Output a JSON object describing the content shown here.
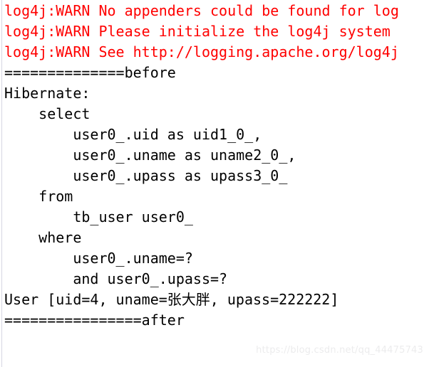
{
  "window": {
    "type": "console-output",
    "background_color": "#ffffff",
    "warn_color": "#ff0000",
    "text_color": "#000000",
    "gutter_color": "#d6d7e2"
  },
  "console": {
    "lines": [
      {
        "text": "log4j:WARN No appenders could be found for log",
        "level": "warn"
      },
      {
        "text": "log4j:WARN Please initialize the log4j system",
        "level": "warn"
      },
      {
        "text": "log4j:WARN See http://logging.apache.org/log4j",
        "level": "warn"
      },
      {
        "text": "==============before",
        "level": "info"
      },
      {
        "text": "Hibernate: ",
        "level": "info"
      },
      {
        "text": "    select",
        "level": "info"
      },
      {
        "text": "        user0_.uid as uid1_0_,",
        "level": "info"
      },
      {
        "text": "        user0_.uname as uname2_0_,",
        "level": "info"
      },
      {
        "text": "        user0_.upass as upass3_0_",
        "level": "info"
      },
      {
        "text": "    from",
        "level": "info"
      },
      {
        "text": "        tb_user user0_",
        "level": "info"
      },
      {
        "text": "    where",
        "level": "info"
      },
      {
        "text": "        user0_.uname=?",
        "level": "info"
      },
      {
        "text": "        and user0_.upass=?",
        "level": "info"
      },
      {
        "text": "User [uid=4, uname=张大胖, upass=222222]",
        "level": "info"
      },
      {
        "text": "================after",
        "level": "info"
      }
    ]
  },
  "watermark": {
    "text": "https://blog.csdn.net/qq_44475743"
  }
}
